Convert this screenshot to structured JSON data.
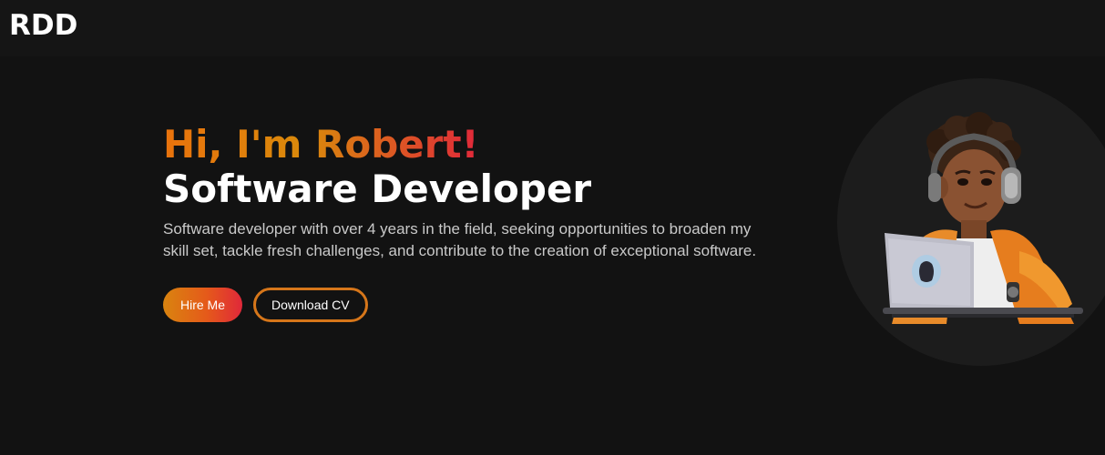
{
  "nav": {
    "logo": "RDD"
  },
  "hero": {
    "greeting": "Hi, I'm Robert!",
    "role": "Software Developer",
    "description": "Software developer with over 4 years in the field, seeking opportunities to broaden my skill set, tackle fresh challenges, and contribute to the creation of exceptional software.",
    "hire_label": "Hire Me",
    "cv_label": "Download CV"
  },
  "colors": {
    "background": "#121212",
    "accent_orange": "#e9720c",
    "accent_red": "#e0283a"
  },
  "icons": {
    "avatar": "developer-avatar-illustration"
  }
}
